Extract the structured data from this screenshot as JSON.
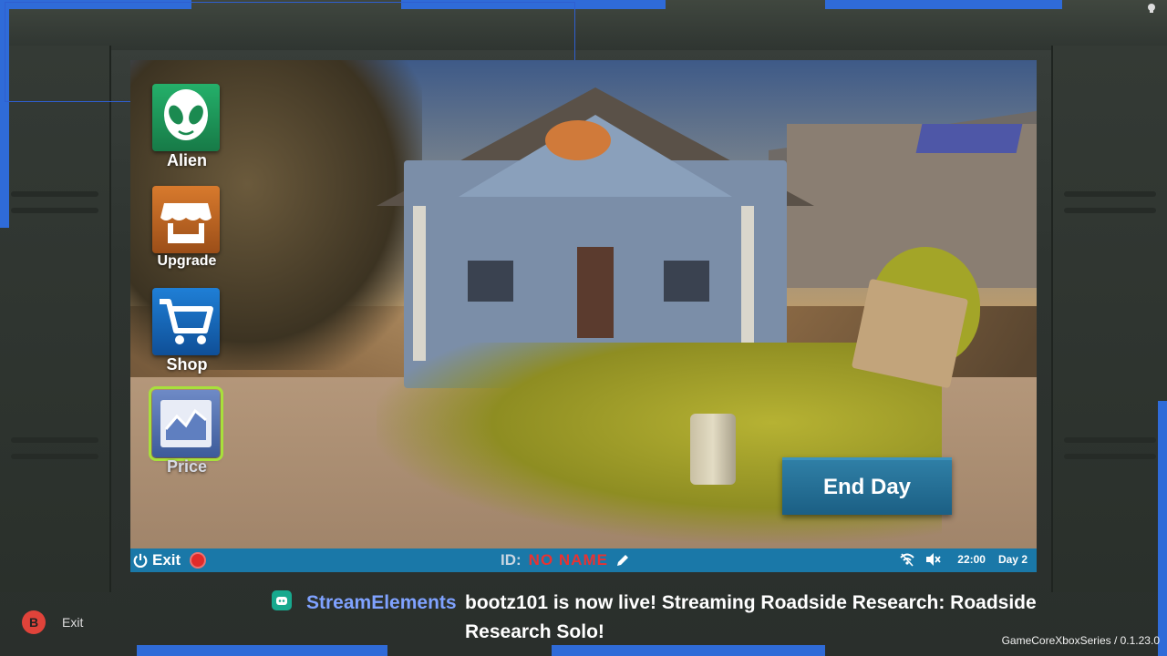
{
  "menu": {
    "items": [
      {
        "label": "Alien",
        "icon": "alien-icon",
        "color": "#1f9a5a"
      },
      {
        "label": "Upgrade",
        "icon": "shop-front-icon",
        "color": "#c46a25"
      },
      {
        "label": "Shop",
        "icon": "shopping-cart-icon",
        "color": "#1b6fc0"
      },
      {
        "label": "Price",
        "icon": "price-chart-icon",
        "color": "#4a6fb5",
        "selected": true
      }
    ]
  },
  "end_day": {
    "label": "End Day"
  },
  "statusbar": {
    "exit_label": "Exit",
    "id_label": "ID:",
    "id_value": "NO NAME",
    "time": "22:00",
    "day": "Day 2"
  },
  "stream": {
    "source": "StreamElements",
    "message": "bootz101 is now live! Streaming Roadside Research: Roadside Research Solo!"
  },
  "controller_hint": {
    "button": "B",
    "label": "Exit"
  },
  "build": {
    "text": "GameCoreXboxSeries / 0.1.23.0"
  },
  "colors": {
    "accent_blue": "#1a78a8",
    "id_red": "#e83232",
    "selected_outline": "#a8e03b"
  }
}
